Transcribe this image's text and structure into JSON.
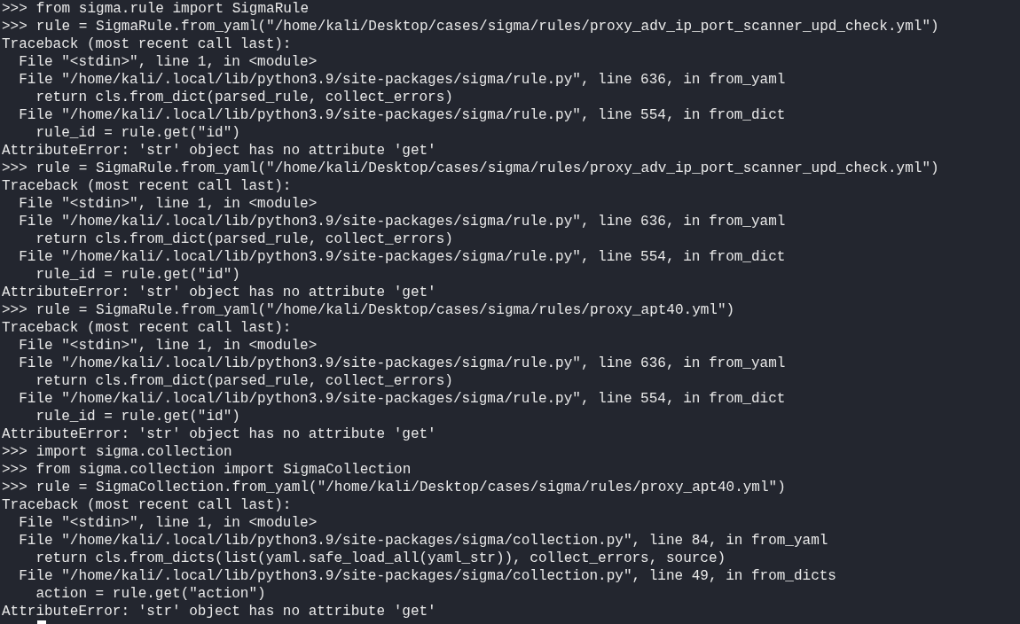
{
  "terminal": {
    "lines": [
      {
        "kind": "input",
        "prompt": ">>>",
        "text": "from sigma.rule import SigmaRule"
      },
      {
        "kind": "input",
        "prompt": ">>>",
        "text": "rule = SigmaRule.from_yaml(\"/home/kali/Desktop/cases/sigma/rules/proxy_adv_ip_port_scanner_upd_check.yml\")"
      },
      {
        "kind": "output",
        "text": "Traceback (most recent call last):"
      },
      {
        "kind": "output",
        "text": "  File \"<stdin>\", line 1, in <module>"
      },
      {
        "kind": "output",
        "text": "  File \"/home/kali/.local/lib/python3.9/site-packages/sigma/rule.py\", line 636, in from_yaml"
      },
      {
        "kind": "output",
        "text": "    return cls.from_dict(parsed_rule, collect_errors)"
      },
      {
        "kind": "output",
        "text": "  File \"/home/kali/.local/lib/python3.9/site-packages/sigma/rule.py\", line 554, in from_dict"
      },
      {
        "kind": "output",
        "text": "    rule_id = rule.get(\"id\")"
      },
      {
        "kind": "output",
        "text": "AttributeError: 'str' object has no attribute 'get'"
      },
      {
        "kind": "input",
        "prompt": ">>>",
        "text": "rule = SigmaRule.from_yaml(\"/home/kali/Desktop/cases/sigma/rules/proxy_adv_ip_port_scanner_upd_check.yml\")"
      },
      {
        "kind": "output",
        "text": "Traceback (most recent call last):"
      },
      {
        "kind": "output",
        "text": "  File \"<stdin>\", line 1, in <module>"
      },
      {
        "kind": "output",
        "text": "  File \"/home/kali/.local/lib/python3.9/site-packages/sigma/rule.py\", line 636, in from_yaml"
      },
      {
        "kind": "output",
        "text": "    return cls.from_dict(parsed_rule, collect_errors)"
      },
      {
        "kind": "output",
        "text": "  File \"/home/kali/.local/lib/python3.9/site-packages/sigma/rule.py\", line 554, in from_dict"
      },
      {
        "kind": "output",
        "text": "    rule_id = rule.get(\"id\")"
      },
      {
        "kind": "output",
        "text": "AttributeError: 'str' object has no attribute 'get'"
      },
      {
        "kind": "input",
        "prompt": ">>>",
        "text": "rule = SigmaRule.from_yaml(\"/home/kali/Desktop/cases/sigma/rules/proxy_apt40.yml\")"
      },
      {
        "kind": "output",
        "text": "Traceback (most recent call last):"
      },
      {
        "kind": "output",
        "text": "  File \"<stdin>\", line 1, in <module>"
      },
      {
        "kind": "output",
        "text": "  File \"/home/kali/.local/lib/python3.9/site-packages/sigma/rule.py\", line 636, in from_yaml"
      },
      {
        "kind": "output",
        "text": "    return cls.from_dict(parsed_rule, collect_errors)"
      },
      {
        "kind": "output",
        "text": "  File \"/home/kali/.local/lib/python3.9/site-packages/sigma/rule.py\", line 554, in from_dict"
      },
      {
        "kind": "output",
        "text": "    rule_id = rule.get(\"id\")"
      },
      {
        "kind": "output",
        "text": "AttributeError: 'str' object has no attribute 'get'"
      },
      {
        "kind": "input",
        "prompt": ">>>",
        "text": "import sigma.collection"
      },
      {
        "kind": "input",
        "prompt": ">>>",
        "text": "from sigma.collection import SigmaCollection"
      },
      {
        "kind": "input",
        "prompt": ">>>",
        "text": "rule = SigmaCollection.from_yaml(\"/home/kali/Desktop/cases/sigma/rules/proxy_apt40.yml\")"
      },
      {
        "kind": "output",
        "text": "Traceback (most recent call last):"
      },
      {
        "kind": "output",
        "text": "  File \"<stdin>\", line 1, in <module>"
      },
      {
        "kind": "output",
        "text": "  File \"/home/kali/.local/lib/python3.9/site-packages/sigma/collection.py\", line 84, in from_yaml"
      },
      {
        "kind": "output",
        "text": "    return cls.from_dicts(list(yaml.safe_load_all(yaml_str)), collect_errors, source)"
      },
      {
        "kind": "output",
        "text": "  File \"/home/kali/.local/lib/python3.9/site-packages/sigma/collection.py\", line 49, in from_dicts"
      },
      {
        "kind": "output",
        "text": "    action = rule.get(\"action\")"
      },
      {
        "kind": "output",
        "text": "AttributeError: 'str' object has no attribute 'get'"
      },
      {
        "kind": "cursor"
      }
    ]
  }
}
